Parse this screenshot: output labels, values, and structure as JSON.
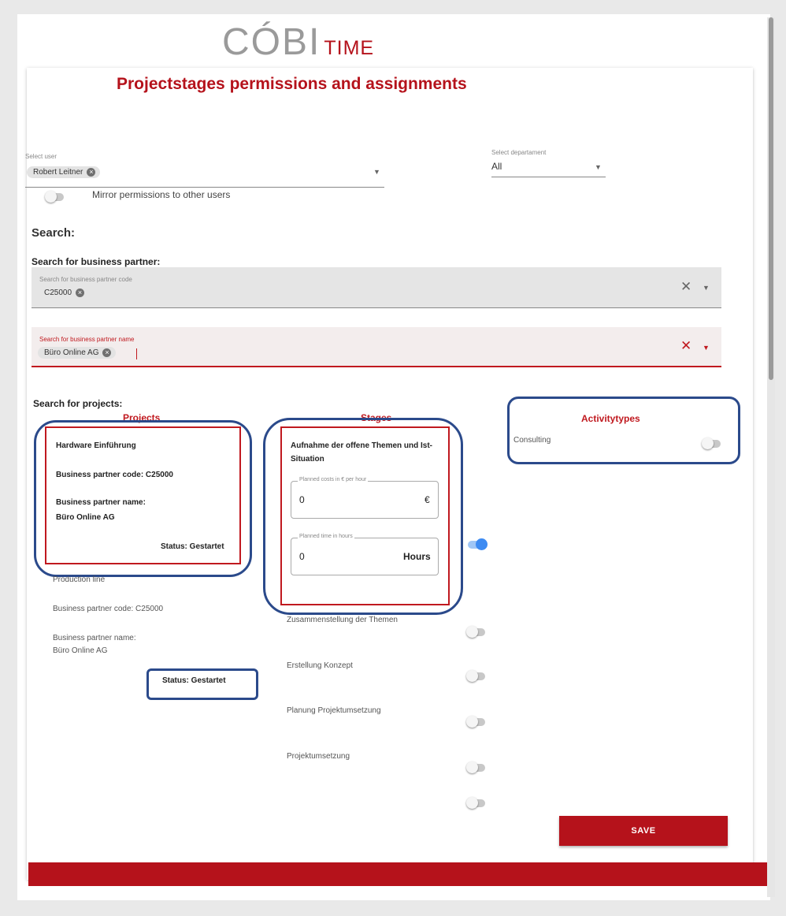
{
  "header": {
    "logo_main": "CÓBI",
    "logo_sub": "TIME",
    "title": "Projectstages permissions and assignments"
  },
  "user_select": {
    "label": "Select user",
    "chip": "Robert Leitner"
  },
  "department_select": {
    "label": "Select departament",
    "value": "All"
  },
  "mirror": {
    "label": "Mirror permissions to other users",
    "on": false
  },
  "search": {
    "heading": "Search:",
    "bp_heading": "Search for business partner:",
    "bp_code_label": "Search for business partner code",
    "bp_code_chip": "C25000",
    "bp_name_label": "Search for business partner name",
    "bp_name_chip": "Büro Online AG",
    "projects_heading": "Search for projects:"
  },
  "columns": {
    "projects": "Projects",
    "stages": "Stages",
    "activitytypes": "Activitytypes"
  },
  "projects": [
    {
      "name": "Hardware Einführung",
      "bp_code": "Business partner code: C25000",
      "bp_name_label": "Business partner name:",
      "bp_name": "Büro Online AG",
      "status": "Status: Gestartet"
    },
    {
      "name": "Production line",
      "bp_code": "Business partner code: C25000",
      "bp_name_label": "Business partner name:",
      "bp_name": "Büro Online AG",
      "status": "Status: Gestartet"
    }
  ],
  "selected_stage": {
    "name": "Aufnahme der offene Themen und Ist-Situation",
    "costs_label": "Planned costs in € per hour",
    "costs_value": "0",
    "costs_unit": "€",
    "time_label": "Planned time in hours",
    "time_value": "0",
    "time_unit": "Hours",
    "enabled": true
  },
  "stages": [
    {
      "name": "Zusammenstellung der Themen",
      "enabled": false
    },
    {
      "name": "Erstellung Konzept",
      "enabled": false
    },
    {
      "name": "Planung Projektumsetzung",
      "enabled": false
    },
    {
      "name": "Projektumsetzung",
      "enabled": false
    },
    {
      "name": "",
      "enabled": false
    }
  ],
  "activitytypes": [
    {
      "name": "Consulting",
      "enabled": false
    }
  ],
  "save_label": "SAVE",
  "colors": {
    "brand_red": "#b5121b",
    "annotation_blue": "#2b4a8b",
    "toggle_on": "#3d8bf2"
  }
}
